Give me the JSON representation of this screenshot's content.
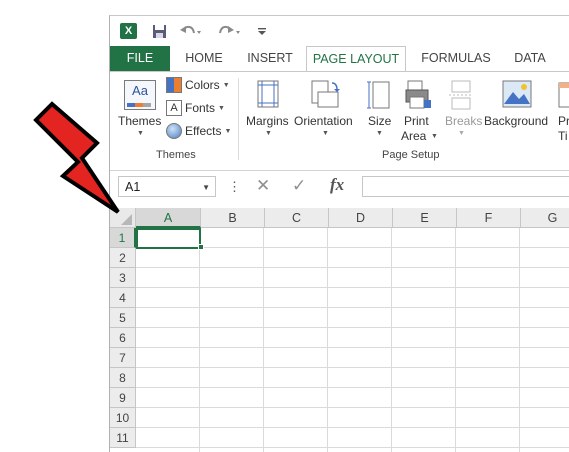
{
  "qat": {
    "app_logo": "X",
    "icons": [
      "excel-logo",
      "save-icon",
      "undo-icon",
      "redo-icon",
      "customize-qat-icon"
    ]
  },
  "tabs": [
    {
      "label": "FILE"
    },
    {
      "label": "HOME"
    },
    {
      "label": "INSERT"
    },
    {
      "label": "PAGE LAYOUT"
    },
    {
      "label": "FORMULAS"
    },
    {
      "label": "DATA"
    }
  ],
  "ribbon": {
    "themes_group": {
      "themes_label": "Themes",
      "colors_label": "Colors",
      "fonts_label": "Fonts",
      "effects_label": "Effects",
      "group_label": "Themes"
    },
    "page_setup_group": {
      "margins_label": "Margins",
      "orientation_label": "Orientation",
      "size_label": "Size",
      "print_area_label_1": "Print",
      "print_area_label_2": "Area",
      "breaks_label": "Breaks",
      "background_label": "Background",
      "print_titles_label_1": "Pr",
      "print_titles_label_2": "Ti",
      "group_label": "Page Setup"
    },
    "theme_icon_text": "Aa",
    "fonts_icon_text": "A"
  },
  "formula_bar": {
    "name_box": "A1",
    "more": "⋮",
    "cancel": "✕",
    "enter": "✓",
    "fx": "fx",
    "formula_value": ""
  },
  "grid": {
    "columns": [
      "A",
      "B",
      "C",
      "D",
      "E",
      "F",
      "G"
    ],
    "rows": [
      "1",
      "2",
      "3",
      "4",
      "5",
      "6",
      "7",
      "8",
      "9",
      "10",
      "11"
    ],
    "selected_cell": "A1"
  },
  "colors": {
    "accent": "#217346",
    "arrow": "#e32420"
  }
}
